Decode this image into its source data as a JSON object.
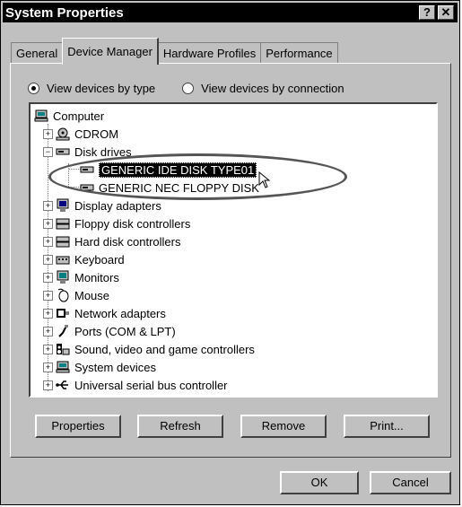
{
  "window": {
    "title": "System Properties",
    "help_label": "?",
    "close_label": "✕"
  },
  "tabs": [
    {
      "label": "General"
    },
    {
      "label": "Device Manager"
    },
    {
      "label": "Hardware Profiles"
    },
    {
      "label": "Performance"
    }
  ],
  "view_options": {
    "by_type": "View devices by type",
    "by_connection": "View devices by connection",
    "selected": "by_type"
  },
  "tree": {
    "root": "Computer",
    "items": [
      {
        "label": "CDROM",
        "expander": "+",
        "icon": "cdrom-icon"
      },
      {
        "label": "Disk drives",
        "expander": "-",
        "icon": "disk-drive-icon"
      },
      {
        "label": "GENERIC IDE  DISK TYPE01",
        "icon": "disk-drive-icon",
        "child": true,
        "selected": true
      },
      {
        "label": "GENERIC NEC  FLOPPY DISK",
        "icon": "disk-drive-icon",
        "child": true
      },
      {
        "label": "Display adapters",
        "expander": "+",
        "icon": "monitor-icon"
      },
      {
        "label": "Floppy disk controllers",
        "expander": "+",
        "icon": "controller-icon"
      },
      {
        "label": "Hard disk controllers",
        "expander": "+",
        "icon": "controller-icon"
      },
      {
        "label": "Keyboard",
        "expander": "+",
        "icon": "keyboard-icon"
      },
      {
        "label": "Monitors",
        "expander": "+",
        "icon": "monitor-icon"
      },
      {
        "label": "Mouse",
        "expander": "+",
        "icon": "mouse-icon"
      },
      {
        "label": "Network adapters",
        "expander": "+",
        "icon": "network-icon"
      },
      {
        "label": "Ports (COM & LPT)",
        "expander": "+",
        "icon": "port-icon"
      },
      {
        "label": "Sound, video and game controllers",
        "expander": "+",
        "icon": "sound-icon"
      },
      {
        "label": "System devices",
        "expander": "+",
        "icon": "system-icon"
      },
      {
        "label": "Universal serial bus controller",
        "expander": "+",
        "icon": "usb-icon"
      }
    ]
  },
  "buttons": {
    "properties": "Properties",
    "refresh": "Refresh",
    "remove": "Remove",
    "print": "Print...",
    "ok": "OK",
    "cancel": "Cancel"
  },
  "colors": {
    "selection": "#000000",
    "face": "#c0c0c0",
    "annotation": "#555555"
  }
}
